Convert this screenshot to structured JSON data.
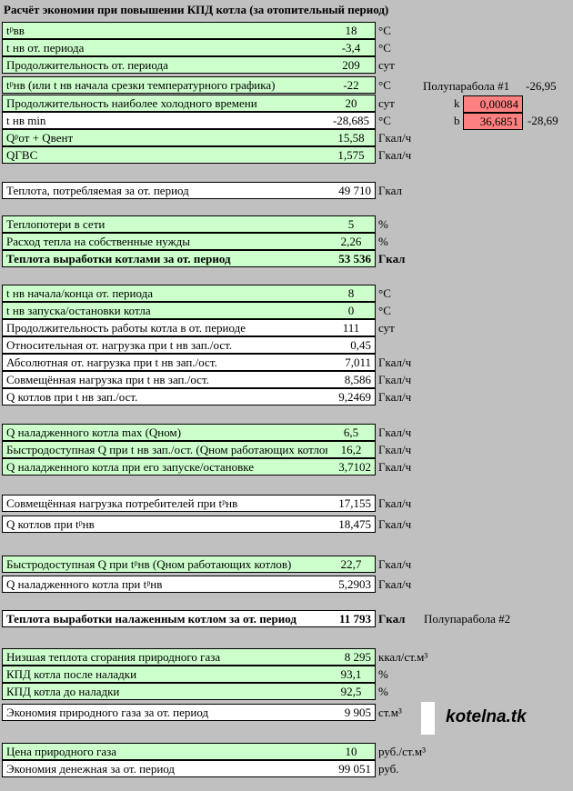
{
  "title": "Расчёт экономии при повышении КПД котла (за отопительный период)",
  "rows": [
    {
      "label": "tᵖвв",
      "value": "18",
      "unit": "°C"
    },
    {
      "label": "t нв от. периода",
      "value": "-3,4",
      "unit": "°C"
    },
    {
      "label": "Продолжительность от. периода",
      "value": "209",
      "unit": "сут"
    },
    {
      "label": "tᵖнв (или t нв начала срезки температурного графика)",
      "value": "-22",
      "unit": "°C"
    },
    {
      "label": "Продолжительность наиболее холодного времени",
      "value": "20",
      "unit": "сут"
    },
    {
      "label": "t нв min",
      "value": "-28,685",
      "unit": "°C"
    },
    {
      "label": "Qᵖот + Qвент",
      "value": "15,58",
      "unit": "Гкал/ч"
    },
    {
      "label": "QГВС",
      "value": "1,575",
      "unit": "Гкал/ч"
    },
    {
      "label": "Теплота, потребляемая за от. период",
      "value": "49 710",
      "unit": "Гкал"
    },
    {
      "label": "Теплопотери в сети",
      "value": "5",
      "unit": "%"
    },
    {
      "label": "Расход тепла на собственные нужды",
      "value": "2,26",
      "unit": "%"
    },
    {
      "label": "Теплота выработки котлами за от. период",
      "value": "53 536",
      "unit": "Гкал"
    },
    {
      "label": "t нв начала/конца от. периода",
      "value": "8",
      "unit": "°C"
    },
    {
      "label": "t нв запуска/остановки котла",
      "value": "0",
      "unit": "°C"
    },
    {
      "label": "Продолжительность работы котла в от. периоде",
      "value": "111",
      "unit": "сут"
    },
    {
      "label": "Относительная от. нагрузка при t нв зап./ост.",
      "value": "0,45",
      "unit": ""
    },
    {
      "label": "Абсолютная от. нагрузка при t нв зап./ост.",
      "value": "7,011",
      "unit": "Гкал/ч"
    },
    {
      "label": "Совмещённая нагрузка при t нв зап./ост.",
      "value": "8,586",
      "unit": "Гкал/ч"
    },
    {
      "label": "Q котлов при t нв зап./ост.",
      "value": "9,2469",
      "unit": "Гкал/ч"
    },
    {
      "label": "Q наладженного котла max (Qном)",
      "value": "6,5",
      "unit": "Гкал/ч"
    },
    {
      "label": "Быстродоступная Q при t нв зап./ост. (Qном работающих котлов)",
      "value": "16,2",
      "unit": "Гкал/ч"
    },
    {
      "label": "Q наладженного котла при его запуске/остановке",
      "value": "3,7102",
      "unit": "Гкал/ч"
    },
    {
      "label": "Совмещённая нагрузка потребителей при tᵖнв",
      "value": "17,155",
      "unit": "Гкал/ч"
    },
    {
      "label": "Q котлов при tᵖнв",
      "value": "18,475",
      "unit": "Гкал/ч"
    },
    {
      "label": "Быстродоступная Q при tᵖнв (Qном работающих котлов)",
      "value": "22,7",
      "unit": "Гкал/ч"
    },
    {
      "label": "Q наладженного котла при tᵖнв",
      "value": "5,2903",
      "unit": "Гкал/ч"
    },
    {
      "label": "Теплота выработки налаженным котлом за от. период",
      "value": "11 793",
      "unit": "Гкал"
    },
    {
      "label": "Низшая теплота сгорания природного газа",
      "value": "8 295",
      "unit": "ккал/ст.м³"
    },
    {
      "label": "КПД котла после наладки",
      "value": "93,1",
      "unit": "%"
    },
    {
      "label": "КПД котла до наладки",
      "value": "92,5",
      "unit": "%"
    },
    {
      "label": "Экономия природного газа за от. период",
      "value": "9 905",
      "unit": "ст.м³"
    },
    {
      "label": "Цена природного газа",
      "value": "10",
      "unit": "руб./ст.м³"
    },
    {
      "label": "Экономия денежная за от. период",
      "value": "99 051",
      "unit": "руб."
    }
  ],
  "side": {
    "parabola1": "Полупарабола #1",
    "parabola1_value": "-26,95",
    "k_label": "k",
    "k_value": "0,00084",
    "b_label": "b",
    "b_value": "36,6851",
    "b_side": "-28,69",
    "parabola2": "Полупарабола #2"
  },
  "logo": "kotelna.tk"
}
